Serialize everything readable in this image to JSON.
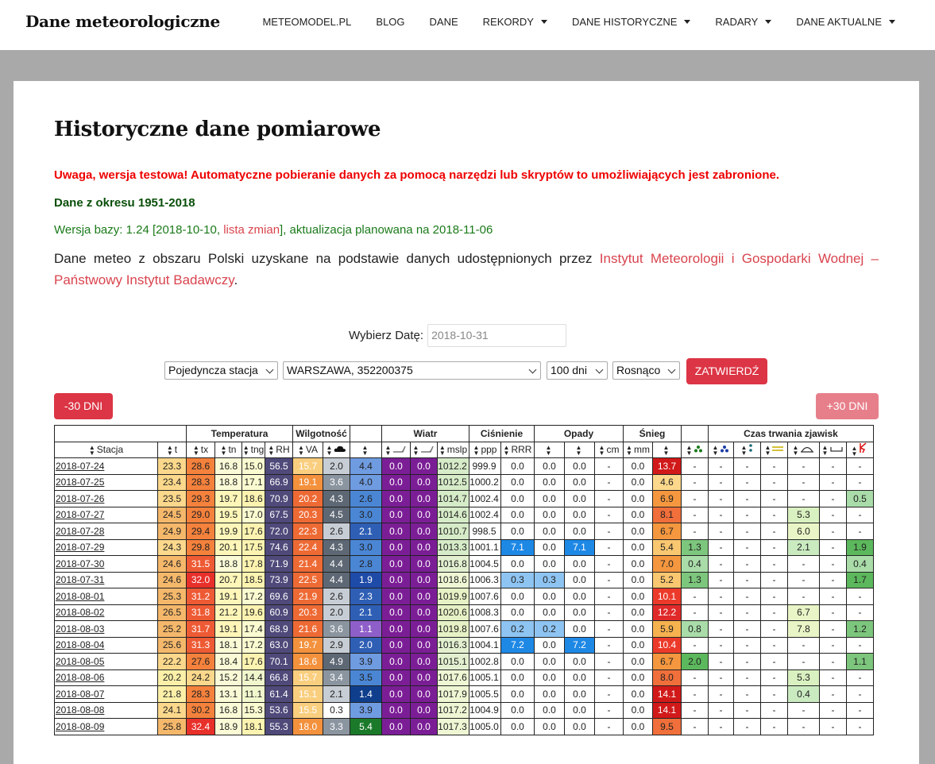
{
  "site": {
    "brand": "Dane meteorologiczne"
  },
  "nav": [
    {
      "label": "METEOMODEL.PL",
      "dropdown": false
    },
    {
      "label": "BLOG",
      "dropdown": false
    },
    {
      "label": "DANE",
      "dropdown": false
    },
    {
      "label": "REKORDY",
      "dropdown": true
    },
    {
      "label": "DANE HISTORYCZNE",
      "dropdown": true
    },
    {
      "label": "RADARY",
      "dropdown": true
    },
    {
      "label": "DANE AKTUALNE",
      "dropdown": true
    }
  ],
  "page": {
    "title": "Historyczne dane pomiarowe",
    "warning": "Uwaga, wersja testowa! Automatyczne pobieranie danych za pomocą narzędzi lub skryptów to umożliwiających jest zabronione.",
    "period": "Dane z okresu 1951-2018",
    "version_prefix": "Wersja bazy: 1.24 [2018-10-10, ",
    "version_link": "lista zmian",
    "version_suffix": "], aktualizacja planowana na 2018-11-06",
    "desc_prefix": "Dane meteo z obszaru Polski uzyskane na podstawie danych udostępnionych przez ",
    "desc_link": "Instytut Meteorologii i Gospodarki Wodnej – Państwowy Instytut Badawczy",
    "desc_suffix": "."
  },
  "form": {
    "date_label": "Wybierz Datę:",
    "date_value": "2018-10-31",
    "mode": "Pojedyncza stacja",
    "station": "WARSZAWA, 352200375",
    "range": "100 dni",
    "order": "Rosnąco",
    "submit": "ZATWIERDŹ",
    "prev": "-30 DNI",
    "next": "+30 DNI"
  },
  "table": {
    "groups": [
      {
        "label": "",
        "span": 2
      },
      {
        "label": "Temperatura",
        "span": 4
      },
      {
        "label": "Wilgotność",
        "span": 2
      },
      {
        "label": "",
        "span": 1
      },
      {
        "label": "Wiatr",
        "span": 3
      },
      {
        "label": "Ciśnienie",
        "span": 2
      },
      {
        "label": "Opady",
        "span": 3
      },
      {
        "label": "Śnieg",
        "span": 2
      },
      {
        "label": "",
        "span": 1
      },
      {
        "label": "Czas trwania zjawisk",
        "span": 7
      }
    ],
    "columns": [
      "Stacja",
      "t",
      "tx",
      "tn",
      "tng",
      "RH",
      "VA",
      "cloud-icon",
      "",
      "wind-icon",
      "wind-icon",
      "mslp",
      "ppp",
      "RRR",
      "",
      "",
      "cm",
      "mm",
      "",
      "rain-icon",
      "snow-icon",
      "sleet-icon",
      "fog-icon",
      "dew-icon",
      "frost-icon",
      "storm-icon"
    ],
    "rows": [
      [
        "2018-07-24",
        "23.3",
        "28.6",
        "16.8",
        "15.0",
        "56.5",
        "15.7",
        "2.0",
        "4.4",
        "0.0",
        "0.0",
        "1012.2",
        "999.9",
        "0.0",
        "0.0",
        "0.0",
        "-",
        "0.0",
        "13.7",
        "-",
        "-",
        "-",
        "-",
        "-",
        "-",
        "-"
      ],
      [
        "2018-07-25",
        "23.4",
        "28.3",
        "18.8",
        "17.1",
        "66.9",
        "19.1",
        "3.6",
        "4.0",
        "0.0",
        "0.0",
        "1012.5",
        "1000.2",
        "0.0",
        "0.0",
        "0.0",
        "-",
        "0.0",
        "4.6",
        "-",
        "-",
        "-",
        "-",
        "-",
        "-",
        "-"
      ],
      [
        "2018-07-26",
        "23.5",
        "29.3",
        "19.7",
        "18.6",
        "70.9",
        "20.2",
        "4.3",
        "2.6",
        "0.0",
        "0.0",
        "1014.7",
        "1002.4",
        "0.0",
        "0.0",
        "0.0",
        "-",
        "0.0",
        "6.9",
        "-",
        "-",
        "-",
        "-",
        "-",
        "-",
        "0.5"
      ],
      [
        "2018-07-27",
        "24.5",
        "29.0",
        "19.5",
        "17.0",
        "67.5",
        "20.3",
        "4.5",
        "3.0",
        "0.0",
        "0.0",
        "1014.6",
        "1002.4",
        "0.0",
        "0.0",
        "0.0",
        "-",
        "0.0",
        "8.1",
        "-",
        "-",
        "-",
        "-",
        "5.3",
        "-",
        "-"
      ],
      [
        "2018-07-28",
        "24.9",
        "29.4",
        "19.9",
        "17.6",
        "72.0",
        "22.3",
        "2.6",
        "2.1",
        "0.0",
        "0.0",
        "1010.7",
        "998.5",
        "0.0",
        "0.0",
        "0.0",
        "-",
        "0.0",
        "6.7",
        "-",
        "-",
        "-",
        "-",
        "6.0",
        "-",
        "-"
      ],
      [
        "2018-07-29",
        "24.3",
        "29.8",
        "20.1",
        "17.5",
        "74.6",
        "22.4",
        "4.3",
        "3.0",
        "0.0",
        "0.0",
        "1013.3",
        "1001.1",
        "7.1",
        "0.0",
        "7.1",
        "-",
        "0.0",
        "5.4",
        "1.3",
        "-",
        "-",
        "-",
        "2.1",
        "-",
        "1.9"
      ],
      [
        "2018-07-30",
        "24.6",
        "31.5",
        "18.8",
        "17.8",
        "71.9",
        "21.4",
        "4.4",
        "2.8",
        "0.0",
        "0.0",
        "1016.8",
        "1004.5",
        "0.0",
        "0.0",
        "0.0",
        "-",
        "0.0",
        "7.0",
        "0.4",
        "-",
        "-",
        "-",
        "-",
        "-",
        "0.4"
      ],
      [
        "2018-07-31",
        "24.6",
        "32.0",
        "20.7",
        "18.5",
        "73.9",
        "22.5",
        "4.4",
        "1.9",
        "0.0",
        "0.0",
        "1018.6",
        "1006.3",
        "0.3",
        "0.3",
        "0.0",
        "-",
        "0.0",
        "5.2",
        "1.3",
        "-",
        "-",
        "-",
        "-",
        "-",
        "1.7"
      ],
      [
        "2018-08-01",
        "25.3",
        "31.2",
        "19.1",
        "17.2",
        "69.6",
        "21.9",
        "2.6",
        "2.3",
        "0.0",
        "0.0",
        "1019.9",
        "1007.6",
        "0.0",
        "0.0",
        "0.0",
        "-",
        "0.0",
        "10.1",
        "-",
        "-",
        "-",
        "-",
        "-",
        "-",
        "-"
      ],
      [
        "2018-08-02",
        "26.5",
        "31.8",
        "21.2",
        "19.6",
        "60.9",
        "20.3",
        "2.0",
        "2.1",
        "0.0",
        "0.0",
        "1020.6",
        "1008.3",
        "0.0",
        "0.0",
        "0.0",
        "-",
        "0.0",
        "12.2",
        "-",
        "-",
        "-",
        "-",
        "6.7",
        "-",
        "-"
      ],
      [
        "2018-08-03",
        "25.2",
        "31.7",
        "19.1",
        "17.4",
        "68.9",
        "21.6",
        "3.6",
        "1.1",
        "0.0",
        "0.0",
        "1019.8",
        "1007.6",
        "0.2",
        "0.2",
        "0.0",
        "-",
        "0.0",
        "5.9",
        "0.8",
        "-",
        "-",
        "-",
        "7.8",
        "-",
        "1.2"
      ],
      [
        "2018-08-04",
        "25.6",
        "31.3",
        "18.1",
        "17.2",
        "63.0",
        "19.7",
        "2.9",
        "2.0",
        "0.0",
        "0.0",
        "1016.3",
        "1004.1",
        "7.2",
        "0.0",
        "7.2",
        "-",
        "0.0",
        "10.4",
        "-",
        "-",
        "-",
        "-",
        "-",
        "-",
        "-"
      ],
      [
        "2018-08-05",
        "22.2",
        "27.6",
        "18.4",
        "17.6",
        "70.1",
        "18.6",
        "4.9",
        "3.9",
        "0.0",
        "0.0",
        "1015.1",
        "1002.8",
        "0.0",
        "0.0",
        "0.0",
        "-",
        "0.0",
        "6.7",
        "2.0",
        "-",
        "-",
        "-",
        "-",
        "-",
        "1.1"
      ],
      [
        "2018-08-06",
        "20.2",
        "24.2",
        "15.2",
        "14.4",
        "66.8",
        "15.7",
        "3.4",
        "3.5",
        "0.0",
        "0.0",
        "1017.6",
        "1005.1",
        "0.0",
        "0.0",
        "0.0",
        "-",
        "0.0",
        "8.0",
        "-",
        "-",
        "-",
        "-",
        "5.3",
        "-",
        "-"
      ],
      [
        "2018-08-07",
        "21.8",
        "28.3",
        "13.1",
        "11.1",
        "61.4",
        "15.1",
        "2.1",
        "1.4",
        "0.0",
        "0.0",
        "1017.9",
        "1005.5",
        "0.0",
        "0.0",
        "0.0",
        "-",
        "0.0",
        "14.1",
        "-",
        "-",
        "-",
        "-",
        "0.4",
        "-",
        "-"
      ],
      [
        "2018-08-08",
        "24.1",
        "30.2",
        "16.8",
        "15.3",
        "53.6",
        "15.5",
        "0.3",
        "3.9",
        "0.0",
        "0.0",
        "1017.2",
        "1004.9",
        "0.0",
        "0.0",
        "0.0",
        "-",
        "0.0",
        "14.1",
        "-",
        "-",
        "-",
        "-",
        "-",
        "-",
        "-"
      ],
      [
        "2018-08-09",
        "25.8",
        "32.4",
        "18.9",
        "18.1",
        "55.3",
        "18.0",
        "3.3",
        "5.4",
        "0.0",
        "0.0",
        "1017.3",
        "1005.0",
        "0.0",
        "0.0",
        "0.0",
        "-",
        "0.0",
        "9.5",
        "-",
        "-",
        "-",
        "-",
        "-",
        "-",
        "-"
      ]
    ]
  }
}
